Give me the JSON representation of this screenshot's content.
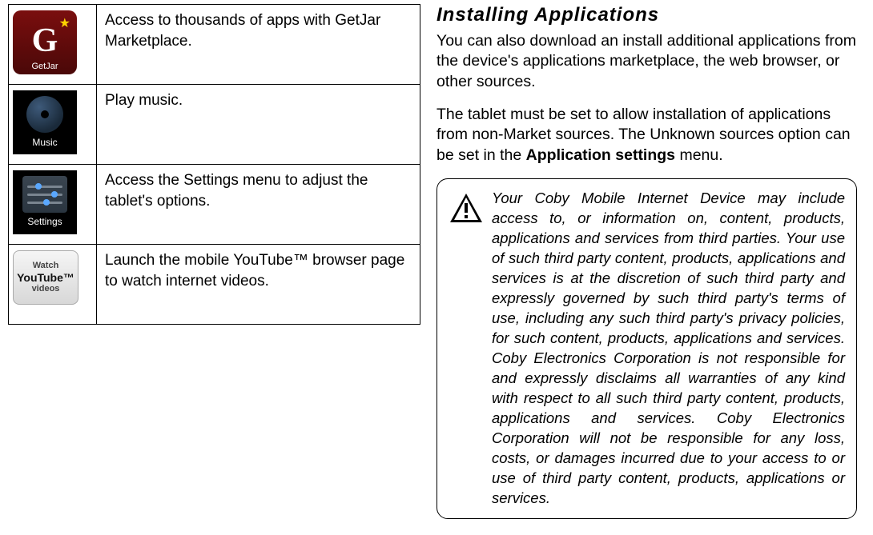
{
  "left": {
    "rows": [
      {
        "icon": "getjar",
        "iconLabel": "GetJar",
        "desc": "Access to thousands of apps with GetJar Marketplace."
      },
      {
        "icon": "music",
        "iconLabel": "Music",
        "desc": "Play music."
      },
      {
        "icon": "settings",
        "iconLabel": "Settings",
        "desc": "Access the Settings menu to adjust the tablet's options."
      },
      {
        "icon": "youtube",
        "yt_top": "Watch",
        "yt_mid": "YouTube™",
        "yt_bot": "videos",
        "desc": "Launch the mobile YouTube™ browser page to watch internet videos."
      }
    ]
  },
  "right": {
    "title": "Installing Applications",
    "p1": "You can also download an install additional applications from the device's applications marketplace, the web browser, or other sources.",
    "p2_a": "The tablet must be set to allow installation of applications from non-Market sources. The Unknown sources option can be set in the ",
    "p2_b": "Application settings",
    "p2_c": " menu.",
    "callout": "Your Coby Mobile Internet Device may include access to, or information on, content, products, applications and services from third parties. Your use of such third party content, products, applications and services is at the discretion of such third party and expressly governed by such third party's terms of use, including any such third party's privacy policies, for such content, products, applications and services. Coby Electronics Corporation is not responsible for and expressly disclaims all warranties of any kind with respect to all such third party content, products, applications and services. Coby Electronics Corporation will not be responsible for any loss, costs, or damages incurred due to your access to or use of third party content, products, applications or services."
  }
}
